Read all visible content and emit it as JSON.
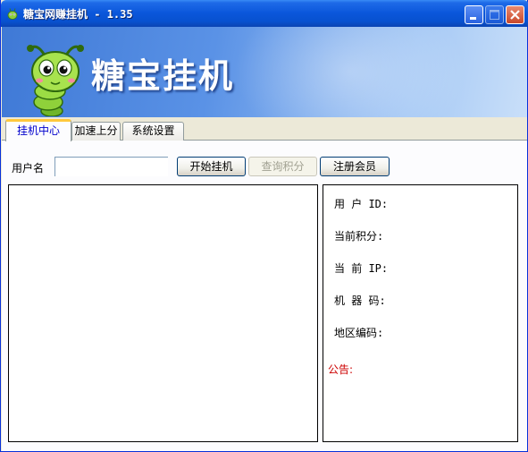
{
  "window": {
    "title": "糖宝网赚挂机 - 1.35",
    "controls": {
      "minimize": "minimize-icon",
      "maximize": "maximize-icon",
      "close": "close-icon"
    }
  },
  "banner": {
    "logo": "caterpillar-mascot",
    "title": "糖宝挂机"
  },
  "tabs": [
    {
      "label": "挂机中心",
      "active": true
    },
    {
      "label": "加速上分",
      "active": false
    },
    {
      "label": "系统设置",
      "active": false
    }
  ],
  "login": {
    "username_label": "用户名",
    "username_value": "",
    "start_button": "开始挂机",
    "query_button": "查询积分",
    "register_button": "注册会员"
  },
  "info": {
    "user_id_label": "用 户 ID:",
    "points_label": "当前积分:",
    "ip_label": "当 前 IP:",
    "machine_label": "机 器 码:",
    "region_label": "地区编码:",
    "notice_label": "公告:"
  },
  "colors": {
    "titlebar": "#0a56da",
    "active_tab_accent": "#ffc83c",
    "notice": "#cc0000",
    "banner_start": "#3f79d6",
    "banner_end": "#c9dff9"
  }
}
